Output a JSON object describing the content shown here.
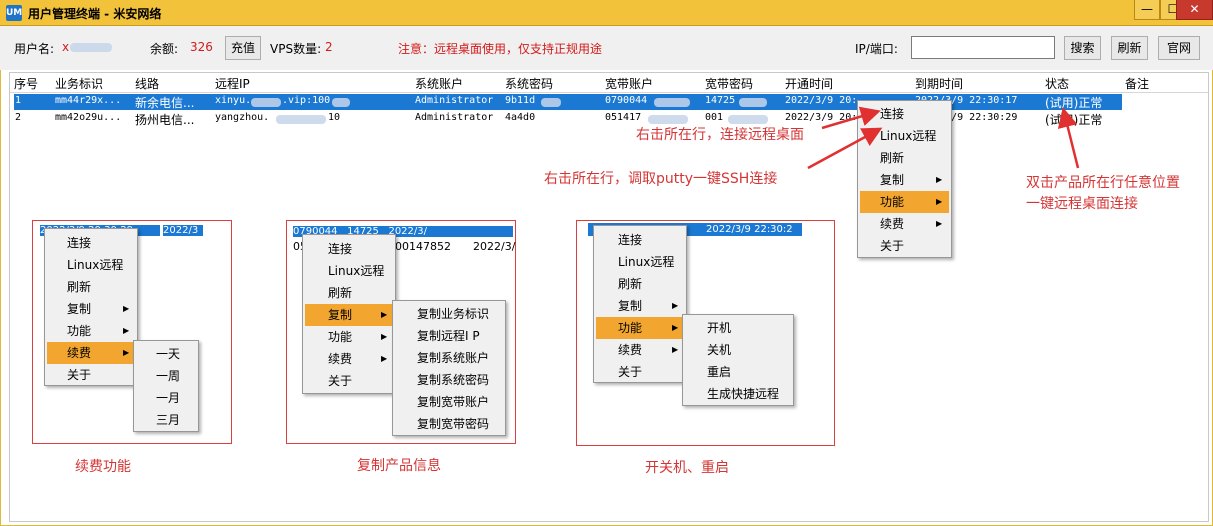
{
  "window": {
    "icon_glyph": "UM",
    "title": "用户管理终端 - 米安网络",
    "min_glyph": "—",
    "max_glyph": "☐",
    "close_glyph": "✕"
  },
  "toolbar": {
    "user_label": "用户名:",
    "user_value": "x",
    "balance_label": "余额:",
    "balance_value": "326",
    "recharge": "充值",
    "vps_label": "VPS数量:",
    "vps_value": "2",
    "notice": "注意：远程桌面使用，仅支持正规用途",
    "ip_label": "IP/端口:",
    "ip_value": "",
    "search": "搜索",
    "refresh": "刷新",
    "website": "官网"
  },
  "table": {
    "columns": [
      "序号",
      "业务标识",
      "线路",
      "远程IP",
      "系统账户",
      "系统密码",
      "宽带账户",
      "宽带密码",
      "开通时间",
      "到期时间",
      "状态",
      "备注"
    ],
    "rows": [
      {
        "no": "1",
        "biz": "mm44r29x...",
        "line": "新余电信...",
        "ip": "xinyu.",
        "ip2": ".vip:100",
        "acct": "Administrator",
        "pwd": "9b11d",
        "bb_acct": "0790044",
        "bb_pwd": "14725",
        "open": "2022/3/9 20:",
        "expire": "2022/3/9 22:30:17",
        "status": "(试用)正常"
      },
      {
        "no": "2",
        "biz": "mm42o29u...",
        "line": "扬州电信...",
        "ip": "yangzhou.",
        "ip2": "10",
        "acct": "Administrator",
        "pwd": "4a4d0",
        "bb_acct": "051417",
        "bb_pwd": "001",
        "open": "2022/3/9 20:",
        "expire": "2022/3/9 22:30:29",
        "status": "(试用)正常"
      }
    ]
  },
  "main_menu": [
    "连接",
    "Linux远程",
    "刷新",
    "复制",
    "功能",
    "续费",
    "关于"
  ],
  "renew_submenu": [
    "一天",
    "一周",
    "一月",
    "三月"
  ],
  "copy_submenu": [
    "复制业务标识",
    "复制远程I P",
    "复制系统账户",
    "复制系统密码",
    "复制宽带账户",
    "复制宽带密码"
  ],
  "function_submenu": [
    "开机",
    "关机",
    "重启",
    "生成快捷远程"
  ],
  "demo1_bg": {
    "a": "2022/3/9 20:30:29",
    "b": "2022/3"
  },
  "demo2_bg": {
    "a": "0790044",
    "b": "14725",
    "c": "2022/3/",
    "d": "05",
    "e": "00147852",
    "f": "2022/3/"
  },
  "demo3_bg": {
    "a": "2022/3/9 22:30:2"
  },
  "annotations": {
    "right_click_connect": "右击所在行，连接远程桌面",
    "right_click_putty": "右击所在行，调取putty一键SSH连接",
    "double_click_1": "双击产品所在行任意位置",
    "double_click_2": "一键远程桌面连接",
    "cap_renew": "续费功能",
    "cap_copy": "复制产品信息",
    "cap_power": "开关机、重启"
  },
  "colors": {
    "titlebar": "#f2c23a",
    "selection": "#1b79d3",
    "menu_highlight": "#f2a630",
    "annotation": "#d43535"
  }
}
